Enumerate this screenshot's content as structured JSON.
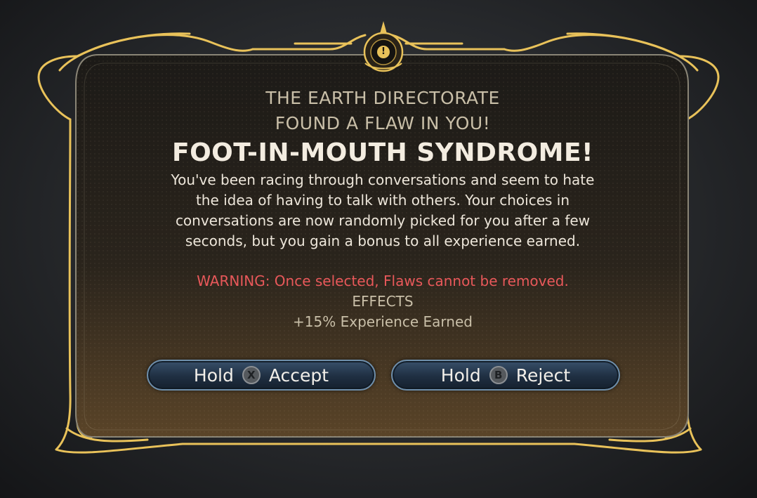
{
  "dialog": {
    "heading_line1": "THE EARTH DIRECTORATE",
    "heading_line2": "FOUND A FLAW IN YOU!",
    "flaw_name": "FOOT-IN-MOUTH SYNDROME!",
    "description": "You've been racing through conversations and seem to hate the idea of having to talk with others. Your choices in conversations are now randomly picked for you after a few seconds, but you gain a bonus to all experience earned.",
    "warning": "WARNING: Once selected, Flaws cannot be removed.",
    "effects_label": "EFFECTS",
    "effects": [
      "+15% Experience Earned"
    ],
    "alert_glyph": "!"
  },
  "buttons": {
    "accept": {
      "hold": "Hold",
      "glyph": "X",
      "label": "Accept"
    },
    "reject": {
      "hold": "Hold",
      "glyph": "B",
      "label": "Reject"
    }
  },
  "colors": {
    "frame_gold": "#e9c25a",
    "panel_dark": "#221f1a",
    "warning_red": "#e8585a",
    "button_border": "#6f8fab"
  }
}
